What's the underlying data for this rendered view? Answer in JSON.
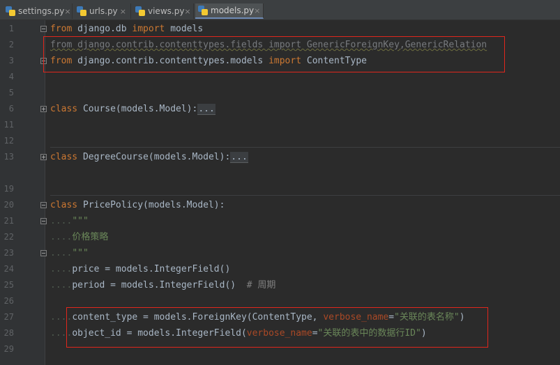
{
  "tabs": [
    {
      "label": "settings.py",
      "active": false
    },
    {
      "label": "urls.py",
      "active": false
    },
    {
      "label": "views.py",
      "active": false
    },
    {
      "label": "models.py",
      "active": true
    }
  ],
  "close_glyph": "×",
  "line_numbers": [
    "1",
    "2",
    "3",
    "4",
    "5",
    "6",
    "11",
    "12",
    "13",
    "19",
    "20",
    "21",
    "22",
    "23",
    "24",
    "25",
    "26",
    "27",
    "28",
    "29"
  ],
  "code": {
    "l1": {
      "kw1": "from",
      "mod": " django.db ",
      "kw2": "import",
      "name": " models"
    },
    "l2": {
      "text": "from django.contrib.contenttypes.fields import GenericForeignKey,GenericRelation"
    },
    "l3": {
      "kw1": "from",
      "mod": " django.contrib.contenttypes.models ",
      "kw2": "import",
      "name": " ContentType"
    },
    "l6": {
      "kw": "class",
      "sig": " Course(models.Model):",
      "fold": "..."
    },
    "l13": {
      "kw": "class",
      "sig": " DegreeCourse(models.Model):",
      "fold": "..."
    },
    "l20": {
      "kw": "class",
      "sig": " PricePolicy(models.Model):"
    },
    "l21": {
      "indent": "....",
      "doc": "\"\"\""
    },
    "l22": {
      "indent": "....",
      "doc": "价格策略"
    },
    "l23": {
      "indent": "....",
      "doc": "\"\"\""
    },
    "l24": {
      "indent": "....",
      "text": "price = models.IntegerField()"
    },
    "l25": {
      "indent": "....",
      "text": "period = models.IntegerField()  ",
      "comment": "# 周期"
    },
    "l27": {
      "indent": "....",
      "pre": "content_type = models.ForeignKey(ContentType, ",
      "kwarg": "verbose_name",
      "eq": "=",
      "str": "\"关联的表名称\"",
      "post": ")"
    },
    "l28": {
      "indent": "....",
      "pre": "object_id = models.IntegerField(",
      "kwarg": "verbose_name",
      "eq": "=",
      "str": "\"关联的表中的数据行ID\"",
      "post": ")"
    }
  }
}
